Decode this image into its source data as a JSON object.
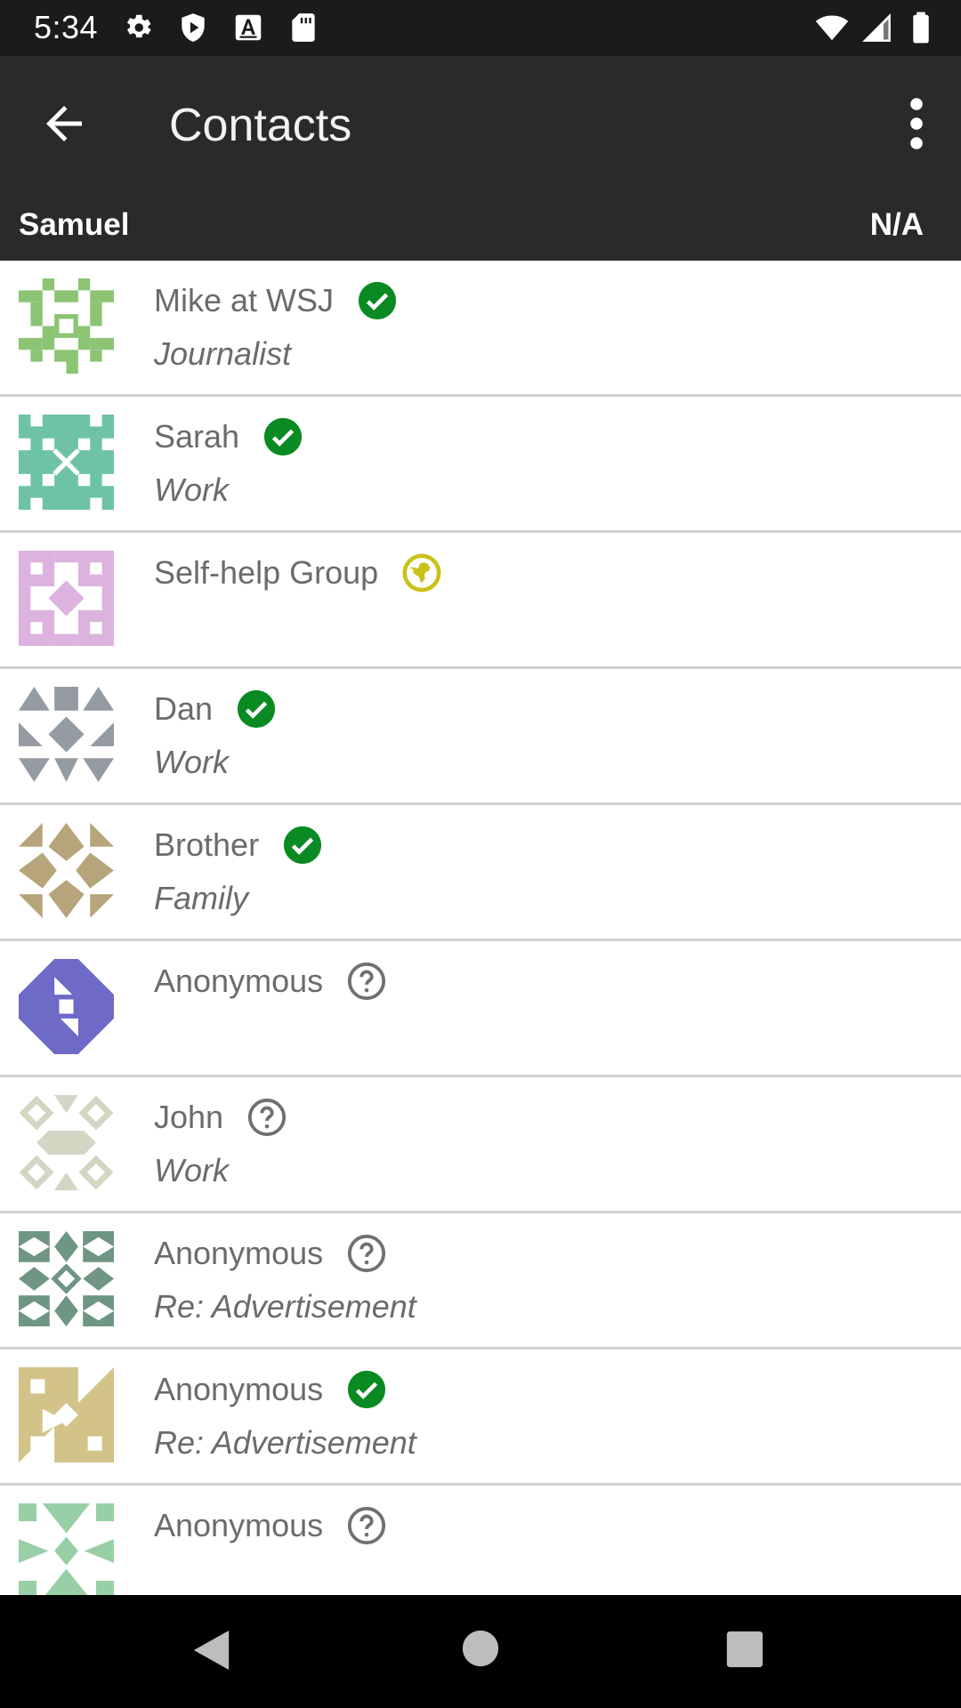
{
  "status_bar": {
    "time": "5:34",
    "icons_left": [
      "settings-icon",
      "shield-icon",
      "font-icon",
      "sd-card-icon"
    ],
    "icons_right": [
      "wifi-icon",
      "cellular-signal-icon",
      "battery-icon"
    ]
  },
  "app_bar": {
    "title": "Contacts",
    "back_icon": "arrow-back-icon",
    "overflow_icon": "more-vert-icon",
    "identity_name": "Samuel",
    "identity_status": "N/A"
  },
  "colors": {
    "status_bar_bg": "#1b1b1c",
    "app_bar_bg": "#2a2a2c",
    "verified_green": "#0a8a22",
    "public_yellow": "#c9c21a",
    "unknown_gray": "#707070",
    "divider": "#d0d0d0"
  },
  "contacts": [
    {
      "name": "Mike at WSJ",
      "subtitle": "Journalist",
      "trust": "verified-icon",
      "avatar_color": "#8cc474"
    },
    {
      "name": "Sarah",
      "subtitle": "Work",
      "trust": "verified-icon",
      "avatar_color": "#6ec3a5"
    },
    {
      "name": "Self-help Group",
      "subtitle": "",
      "trust": "globe-icon",
      "avatar_color": "#dcb3de"
    },
    {
      "name": "Dan",
      "subtitle": "Work",
      "trust": "verified-icon",
      "avatar_color": "#959ba2"
    },
    {
      "name": "Brother",
      "subtitle": "Family",
      "trust": "verified-icon",
      "avatar_color": "#b6a57a"
    },
    {
      "name": "Anonymous",
      "subtitle": "",
      "trust": "question-icon",
      "avatar_color": "#6e6ac8"
    },
    {
      "name": "John",
      "subtitle": "Work",
      "trust": "question-icon",
      "avatar_color": "#d5d5c3"
    },
    {
      "name": "Anonymous",
      "subtitle": "Re: Advertisement",
      "trust": "question-icon",
      "avatar_color": "#6f9583"
    },
    {
      "name": "Anonymous",
      "subtitle": "Re: Advertisement",
      "trust": "verified-icon",
      "avatar_color": "#d2c389"
    },
    {
      "name": "Anonymous",
      "subtitle": "",
      "trust": "question-icon",
      "avatar_color": "#98cfa6"
    }
  ],
  "nav_bar": {
    "icons": [
      "nav-back-icon",
      "nav-home-icon",
      "nav-recents-icon"
    ]
  }
}
